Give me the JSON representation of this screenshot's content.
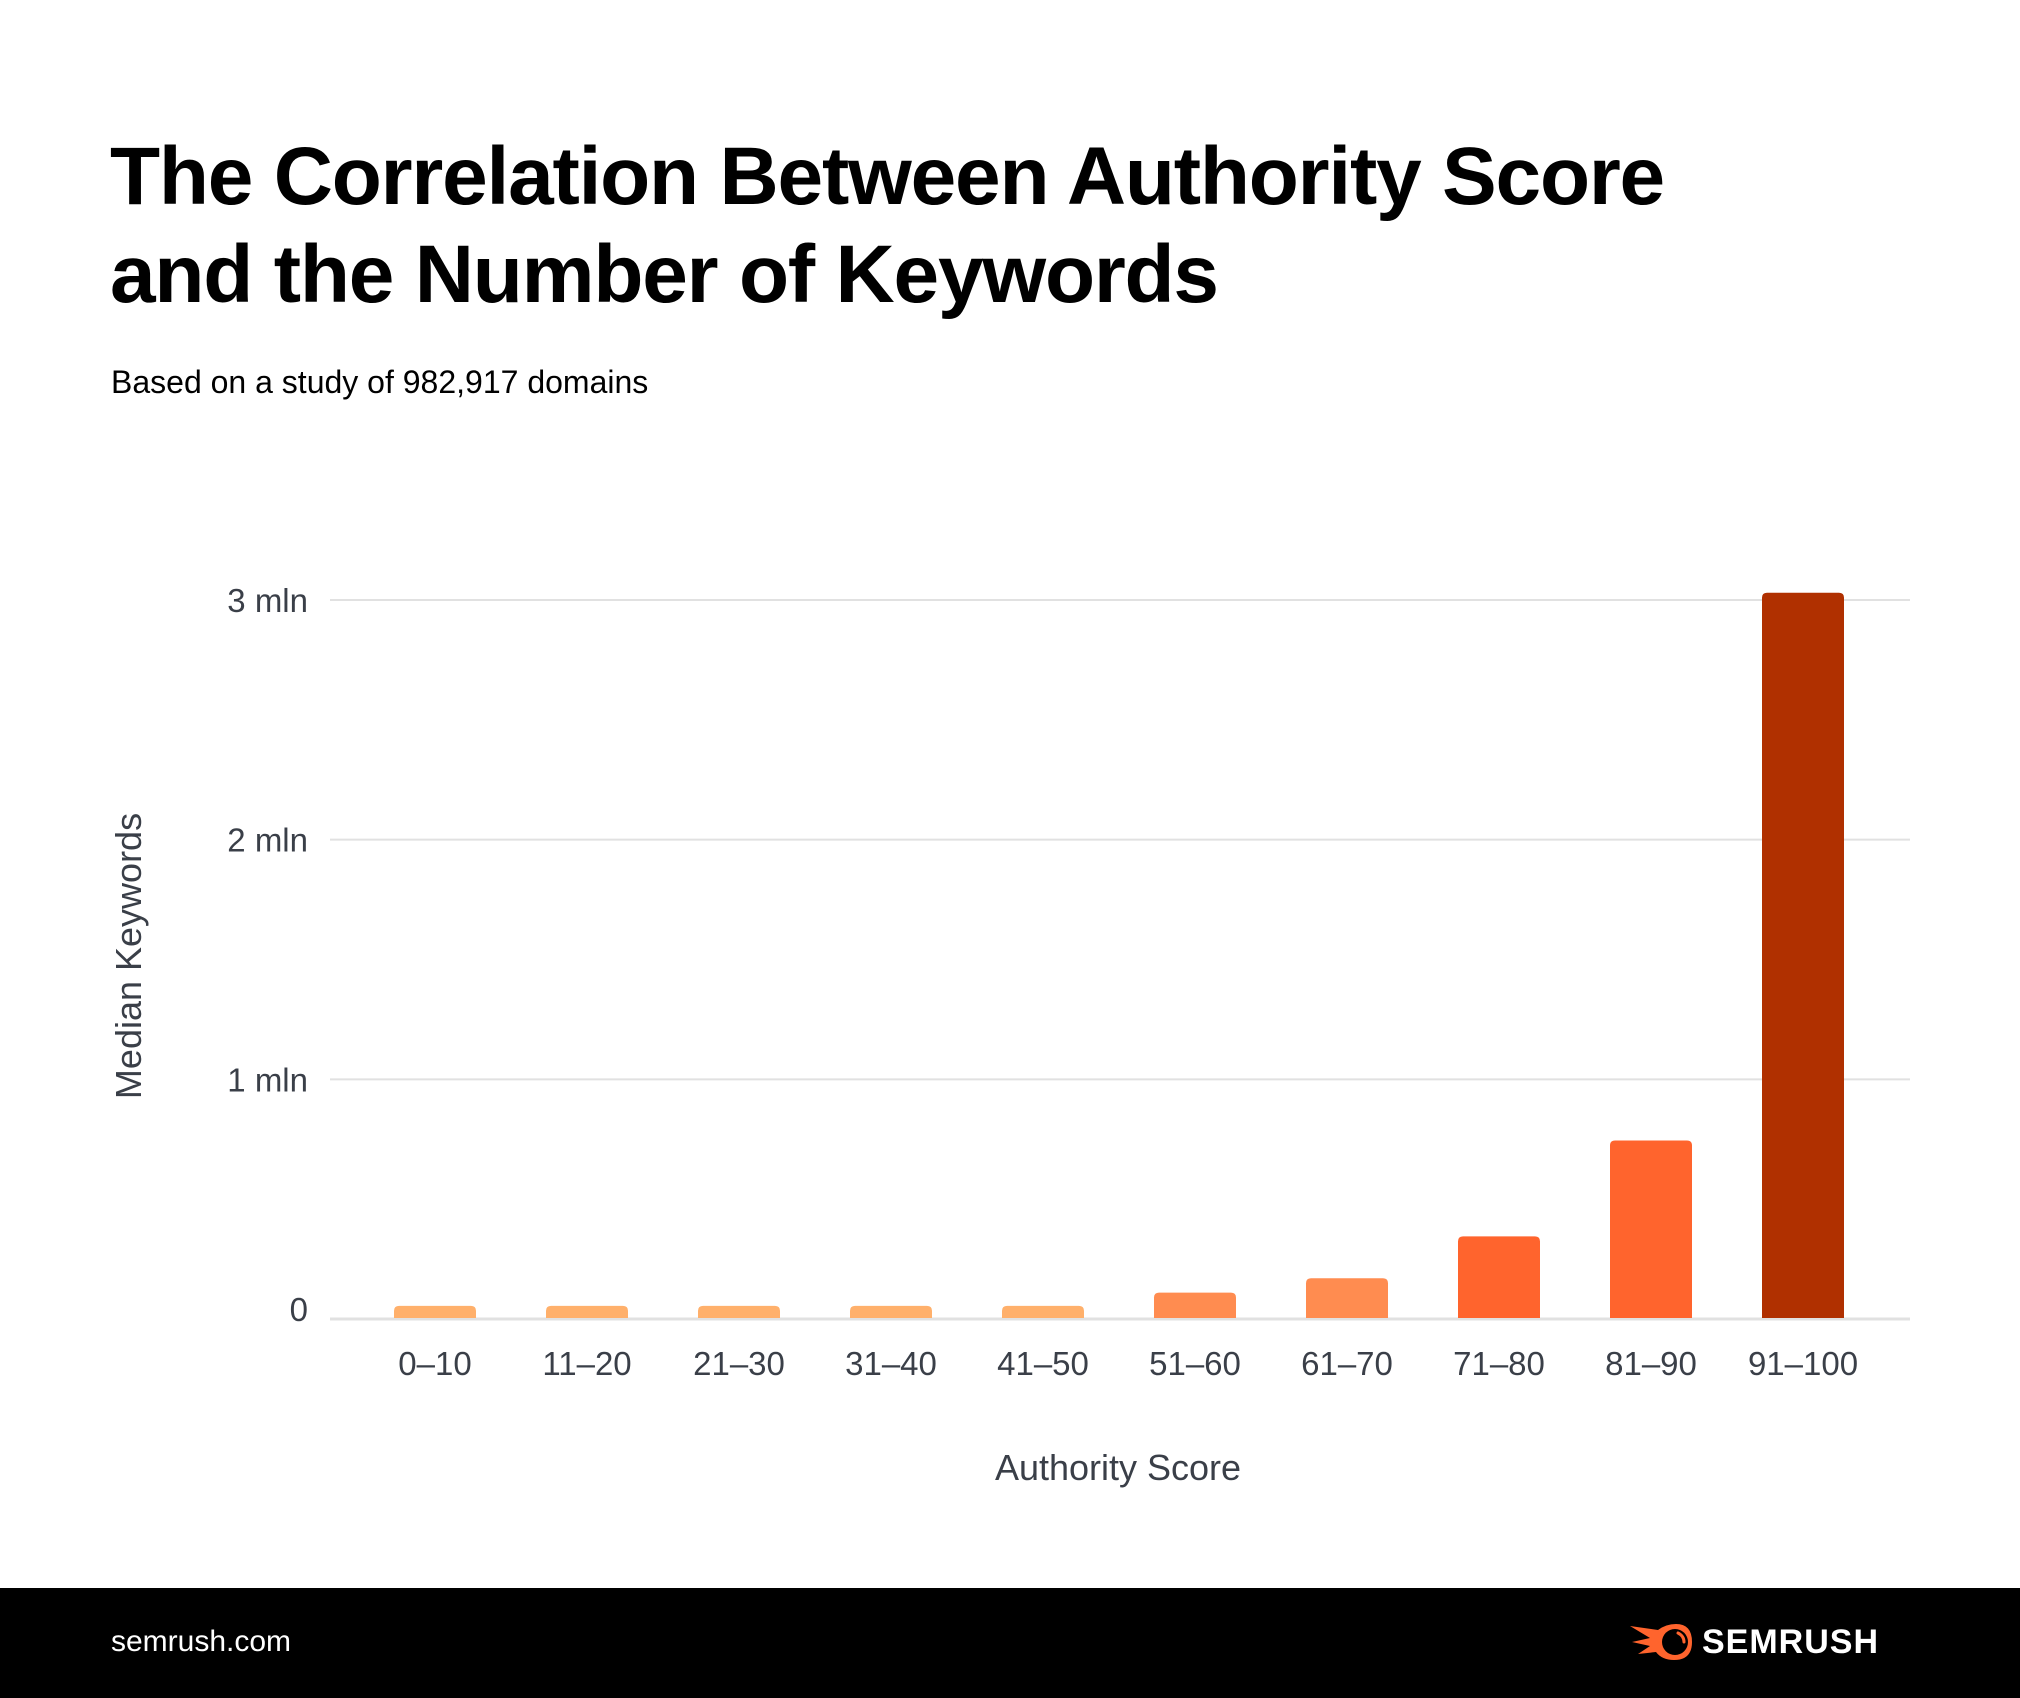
{
  "header": {
    "title_line1": "The Correlation Between Authority Score",
    "title_line2": "and the Number of Keywords",
    "subtitle": "Based on a study of 982,917 domains"
  },
  "footer": {
    "site": "semrush.com",
    "logo_icon": "semrush-comet-icon",
    "logo_text": "SEMRUSH",
    "logo_color": "#FF642D"
  },
  "chart_data": {
    "type": "bar",
    "title": "The Correlation Between Authority Score and the Number of Keywords",
    "subtitle": "Based on a study of 982,917 domains",
    "xlabel": "Authority Score",
    "ylabel": "Median Keywords",
    "categories": [
      "0–10",
      "11–20",
      "21–30",
      "31–40",
      "41–50",
      "51–60",
      "61–70",
      "71–80",
      "81–90",
      "91–100"
    ],
    "values": [
      55000,
      55000,
      55000,
      55000,
      55000,
      110000,
      170000,
      345000,
      745000,
      3030000
    ],
    "colors": [
      "#FFB06B",
      "#FFB06B",
      "#FFB06B",
      "#FFB06B",
      "#FFB06B",
      "#FF8C50",
      "#FF8C50",
      "#FF642D",
      "#FF642D",
      "#B03000"
    ],
    "ylim": [
      0,
      3000000
    ],
    "yticks": [
      0,
      1000000,
      2000000,
      3000000
    ],
    "ytick_labels": [
      "0",
      "1 mln",
      "2 mln",
      "3 mln"
    ],
    "grid": true,
    "legend": "none"
  }
}
